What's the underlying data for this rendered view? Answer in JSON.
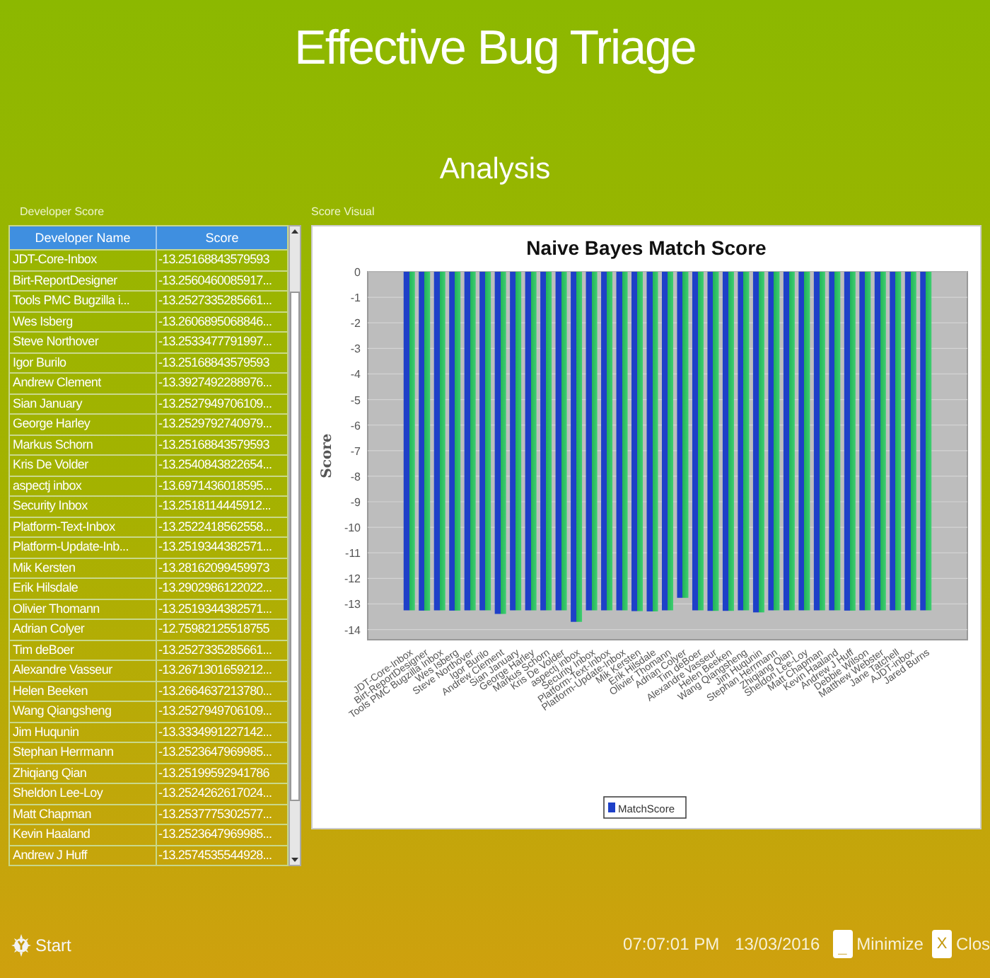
{
  "app": {
    "title": "Effective Bug Triage",
    "subtitle": "Analysis"
  },
  "developer_score": {
    "label": "Developer Score",
    "columns": [
      "Developer Name",
      "Score"
    ],
    "rows": [
      [
        "JDT-Core-Inbox",
        "-13.25168843579593"
      ],
      [
        "Birt-ReportDesigner",
        "-13.2560460085917..."
      ],
      [
        "Tools PMC Bugzilla i...",
        "-13.2527335285661..."
      ],
      [
        "Wes Isberg",
        "-13.2606895068846..."
      ],
      [
        "Steve Northover",
        "-13.2533477791997..."
      ],
      [
        "Igor Burilo",
        "-13.25168843579593"
      ],
      [
        "Andrew Clement",
        "-13.3927492288976..."
      ],
      [
        "Sian January",
        "-13.2527949706109..."
      ],
      [
        "George Harley",
        "-13.2529792740979..."
      ],
      [
        "Markus Schorn",
        "-13.25168843579593"
      ],
      [
        "Kris De Volder",
        "-13.2540843822654..."
      ],
      [
        "aspectj inbox",
        "-13.6971436018595..."
      ],
      [
        "Security Inbox",
        "-13.2518114445912..."
      ],
      [
        "Platform-Text-Inbox",
        "-13.2522418562558..."
      ],
      [
        "Platform-Update-Inb...",
        "-13.2519344382571..."
      ],
      [
        "Mik Kersten",
        "-13.28162099459973"
      ],
      [
        "Erik Hilsdale",
        "-13.2902986122022..."
      ],
      [
        "Olivier Thomann",
        "-13.2519344382571..."
      ],
      [
        "Adrian Colyer",
        "-12.75982125518755"
      ],
      [
        "Tim deBoer",
        "-13.2527335285661..."
      ],
      [
        "Alexandre Vasseur",
        "-13.2671301659212..."
      ],
      [
        "Helen Beeken",
        "-13.2664637213780..."
      ],
      [
        "Wang Qiangsheng",
        "-13.2527949706109..."
      ],
      [
        "Jim Huqunin",
        "-13.3334991227142..."
      ],
      [
        "Stephan Herrmann",
        "-13.2523647969985..."
      ],
      [
        "Zhiqiang Qian",
        "-13.25199592941786"
      ],
      [
        "Sheldon Lee-Loy",
        "-13.2524262617024..."
      ],
      [
        "Matt Chapman",
        "-13.2537775302577..."
      ],
      [
        "Kevin Haaland",
        "-13.2523647969985..."
      ],
      [
        "Andrew J Huff",
        "-13.2574535544928..."
      ]
    ]
  },
  "score_visual": {
    "label": "Score Visual",
    "chart_data": {
      "type": "bar",
      "title": "Naive Bayes Match Score",
      "ylabel": "Score",
      "categories": [
        "JDT-Core-Inbox",
        "Birt-ReportDesigner",
        "Tools PMC Bugzilla Inbox",
        "Wes Isberg",
        "Steve Northover",
        "Igor Burilo",
        "Andrew Clement",
        "Sian January",
        "George Harley",
        "Markus Schorn",
        "Kris De Volder",
        "aspectj inbox",
        "Security Inbox",
        "Platform-Text-Inbox",
        "Platform-Update-Inbox",
        "Mik Kersten",
        "Erik Hilsdale",
        "Olivier Thomann",
        "Adrian Colyer",
        "Tim deBoer",
        "Alexandre Vasseur",
        "Helen Beeken",
        "Wang Qiangsheng",
        "Jim Huqunin",
        "Stephan Herrmann",
        "Zhiqiang Qian",
        "Sheldon Lee-Loy",
        "Matt Chapman",
        "Kevin Haaland",
        "Andrew J Huff",
        "Debbie Wilson",
        "Matthew Webster",
        "Jane Tatchell",
        "AJDT-inbox",
        "Jared Burns"
      ],
      "series": [
        {
          "name": "MatchScore",
          "color": "#1e40c8",
          "values": [
            -13.25,
            -13.26,
            -13.25,
            -13.26,
            -13.25,
            -13.25,
            -13.39,
            -13.25,
            -13.25,
            -13.25,
            -13.25,
            -13.7,
            -13.25,
            -13.25,
            -13.25,
            -13.28,
            -13.29,
            -13.25,
            -12.76,
            -13.25,
            -13.27,
            -13.27,
            -13.25,
            -13.33,
            -13.25,
            -13.25,
            -13.25,
            -13.25,
            -13.25,
            -13.26,
            -13.25,
            -13.25,
            -13.25,
            -13.25,
            -13.25
          ]
        }
      ],
      "ylim": [
        -14.4,
        0
      ],
      "grid": true,
      "yticks": [
        0,
        -1,
        -2,
        -3,
        -4,
        -5,
        -6,
        -7,
        -8,
        -9,
        -10,
        -11,
        -12,
        -13,
        -14
      ]
    }
  },
  "taskbar": {
    "start": "Start",
    "time": "07:07:01 PM",
    "date": "13/03/2016",
    "minimize_icon": "_",
    "minimize": "Minimize",
    "close_icon": "X",
    "close": "Clos"
  }
}
